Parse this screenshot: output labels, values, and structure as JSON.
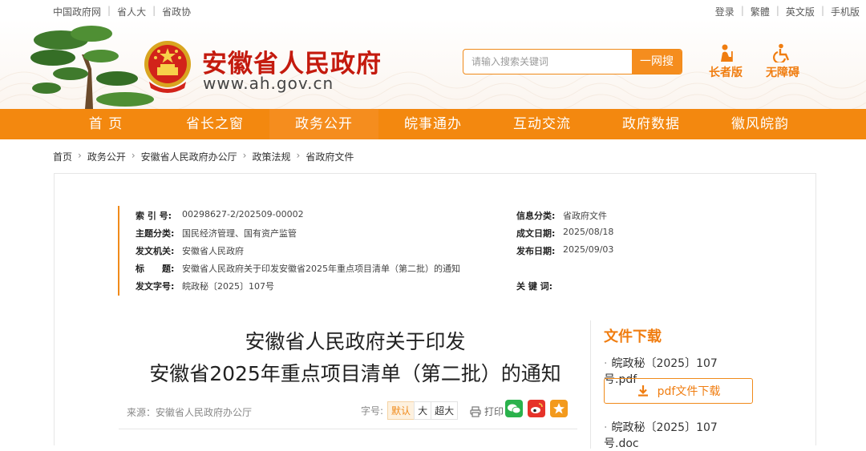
{
  "topbar": {
    "links_left": [
      "中国政府网",
      "省人大",
      "省政协"
    ],
    "links_right": [
      "登录",
      "繁體",
      "英文版",
      "手机版"
    ]
  },
  "header": {
    "title": "安徽省人民政府",
    "url": "www.ah.gov.cn",
    "search_placeholder": "请输入搜索关键词",
    "search_button": "一网搜",
    "elder_mode": "长者版",
    "accessibility": "无障碍"
  },
  "nav": {
    "items": [
      "首 页",
      "省长之窗",
      "政务公开",
      "皖事通办",
      "互动交流",
      "政府数据",
      "徽风皖韵"
    ],
    "active_index": 2
  },
  "breadcrumb": [
    "首页",
    "政务公开",
    "安徽省人民政府办公厅",
    "政策法规",
    "省政府文件"
  ],
  "meta": {
    "index_label": "索 引 号:",
    "index_value": "00298627-2/202509-00002",
    "topic_label": "主题分类:",
    "topic_value": "国民经济管理、国有资产监管",
    "issuer_label": "发文机关:",
    "issuer_value": "安徽省人民政府",
    "title_label": "标　　题:",
    "title_value": "安徽省人民政府关于印发安徽省2025年重点项目清单（第二批）的通知",
    "docno_label": "发文字号:",
    "docno_value": "皖政秘〔2025〕107号",
    "category_label": "信息分类:",
    "category_value": "省政府文件",
    "created_label": "成文日期:",
    "created_value": "2025/08/18",
    "published_label": "发布日期:",
    "published_value": "2025/09/03",
    "keywords_label": "关 键 词:",
    "keywords_value": ""
  },
  "document": {
    "title_line1": "安徽省人民政府关于印发",
    "title_line2": "安徽省2025年重点项目清单（第二批）的通知",
    "source": "来源：安徽省人民政府办公厅",
    "font_size_label": "字号:",
    "font_sizes": [
      "默认",
      "大",
      "超大"
    ],
    "print_label": "打印"
  },
  "downloads": {
    "heading": "文件下载",
    "file1": "皖政秘〔2025〕107号.pdf",
    "file1_button": "pdf文件下载",
    "file2": "皖政秘〔2025〕107号.doc"
  },
  "colors": {
    "brand_orange": "#f3880f",
    "title_red": "#c41a0e"
  }
}
